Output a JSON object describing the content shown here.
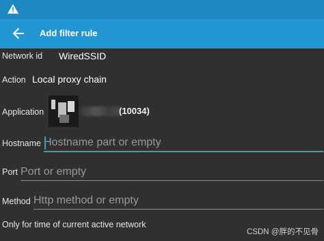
{
  "status_bar": {
    "icon": "warning-icon",
    "color": "#1e88c3"
  },
  "app_bar": {
    "title": "Add filter rule",
    "back_icon": "arrow-left-icon",
    "color": "#2196d3"
  },
  "form": {
    "network_id": {
      "label": "Network id",
      "value": "WiredSSID"
    },
    "action": {
      "label": "Action",
      "value": "Local proxy chain"
    },
    "application": {
      "label": "Application",
      "uid": "(10034)"
    },
    "hostname": {
      "label": "Hostname",
      "placeholder": "Hostname part or empty",
      "value": ""
    },
    "port": {
      "label": "Port",
      "placeholder": "Port or empty",
      "value": ""
    },
    "method": {
      "label": "Method",
      "placeholder": "Http method or empty",
      "value": ""
    },
    "note": "Only for time of current active network"
  },
  "watermark": "CSDN @胖的不见骨",
  "accent_color": "#2aa6b6"
}
